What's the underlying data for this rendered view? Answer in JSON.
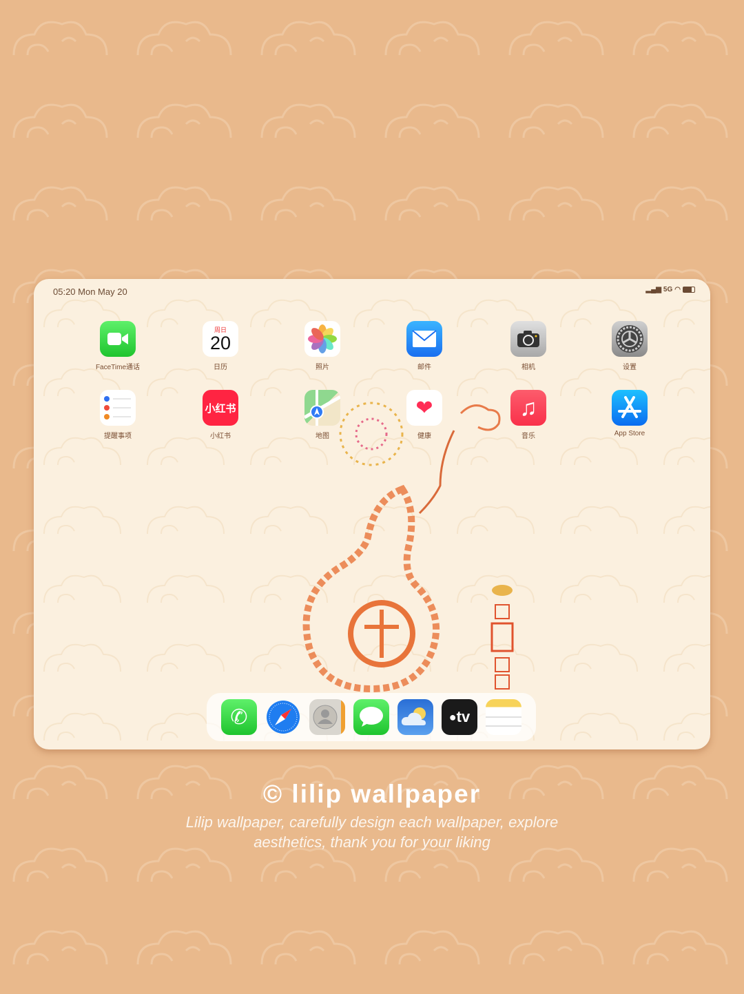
{
  "status": {
    "time": "05:20 Mon May 20",
    "network": "5G",
    "signal_icon": "signal-icon",
    "wifi_icon": "wifi-icon",
    "battery_icon": "battery-icon"
  },
  "apps": [
    {
      "label": "FaceTime通话",
      "icon": "facetime-icon"
    },
    {
      "label": "日历",
      "icon": "calendar-icon",
      "weekday": "周日",
      "day": "20"
    },
    {
      "label": "照片",
      "icon": "photos-icon"
    },
    {
      "label": "邮件",
      "icon": "mail-icon"
    },
    {
      "label": "相机",
      "icon": "camera-icon"
    },
    {
      "label": "设置",
      "icon": "settings-icon"
    },
    {
      "label": "提醒事项",
      "icon": "reminders-icon"
    },
    {
      "label": "小红书",
      "icon": "xiaohongshu-icon",
      "icon_text": "小红书"
    },
    {
      "label": "地图",
      "icon": "maps-icon"
    },
    {
      "label": "健康",
      "icon": "health-icon"
    },
    {
      "label": "音乐",
      "icon": "music-icon"
    },
    {
      "label": "App Store",
      "icon": "app-store-icon"
    }
  ],
  "dock": [
    {
      "icon": "phone-icon"
    },
    {
      "icon": "safari-icon"
    },
    {
      "icon": "contacts-icon"
    },
    {
      "icon": "messages-icon"
    },
    {
      "icon": "weather-icon"
    },
    {
      "icon": "apple-tv-icon",
      "icon_text": "tv"
    },
    {
      "icon": "notes-icon"
    }
  ],
  "brand": {
    "title": "© lilip wallpaper",
    "line1": "Lilip wallpaper, carefully design each wallpaper, explore",
    "line2": "aesthetics, thank you for your liking"
  },
  "colors": {
    "background": "#e9b98c",
    "screen": "#fbf0df",
    "accent": "#e8743a"
  }
}
